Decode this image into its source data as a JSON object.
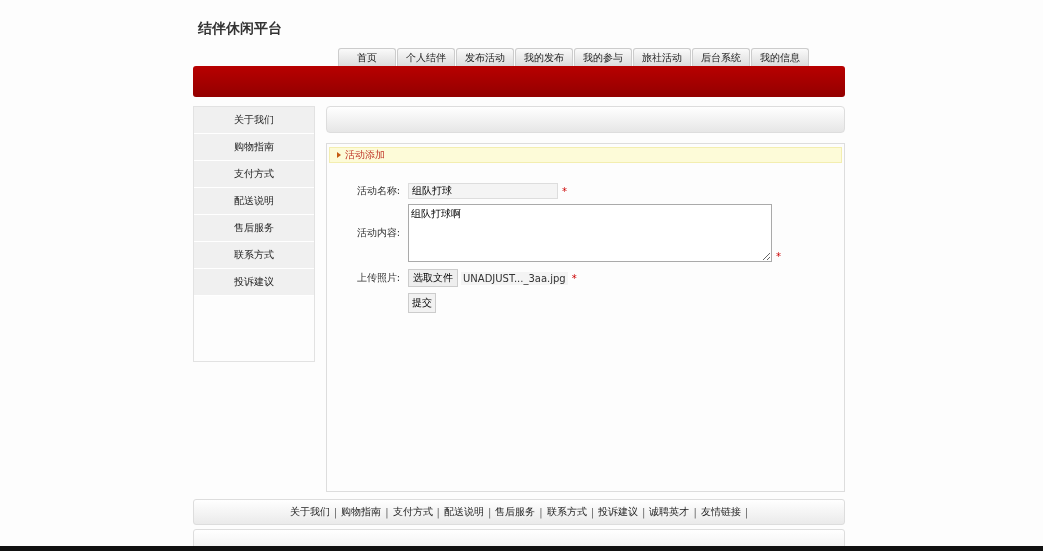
{
  "site_title": "结伴休闲平台",
  "nav": [
    {
      "label": "首页",
      "selected": false
    },
    {
      "label": "个人结伴",
      "selected": false
    },
    {
      "label": "发布活动",
      "selected": false
    },
    {
      "label": "我的发布",
      "selected": false
    },
    {
      "label": "我的参与",
      "selected": false
    },
    {
      "label": "旅社活动",
      "selected": false
    },
    {
      "label": "后台系统",
      "selected": false
    },
    {
      "label": "我的信息",
      "selected": false
    }
  ],
  "sidebar": {
    "items": [
      "关于我们",
      "购物指南",
      "支付方式",
      "配送说明",
      "售后服务",
      "联系方式",
      "投诉建议"
    ]
  },
  "panel": {
    "title": "活动添加",
    "form": {
      "name_label": "活动名称:",
      "name_value": "组队打球",
      "content_label": "活动内容:",
      "content_value": "组队打球啊",
      "photo_label": "上传照片:",
      "file_button": "选取文件",
      "file_name": "UNADJUST..._3aa.jpg",
      "required_mark": "*",
      "submit": "提交"
    }
  },
  "footer": {
    "links": [
      "关于我们",
      "购物指南",
      "支付方式",
      "配送说明",
      "售后服务",
      "联系方式",
      "投诉建议",
      "诚聘英才",
      "友情链接"
    ],
    "separator": "|"
  }
}
